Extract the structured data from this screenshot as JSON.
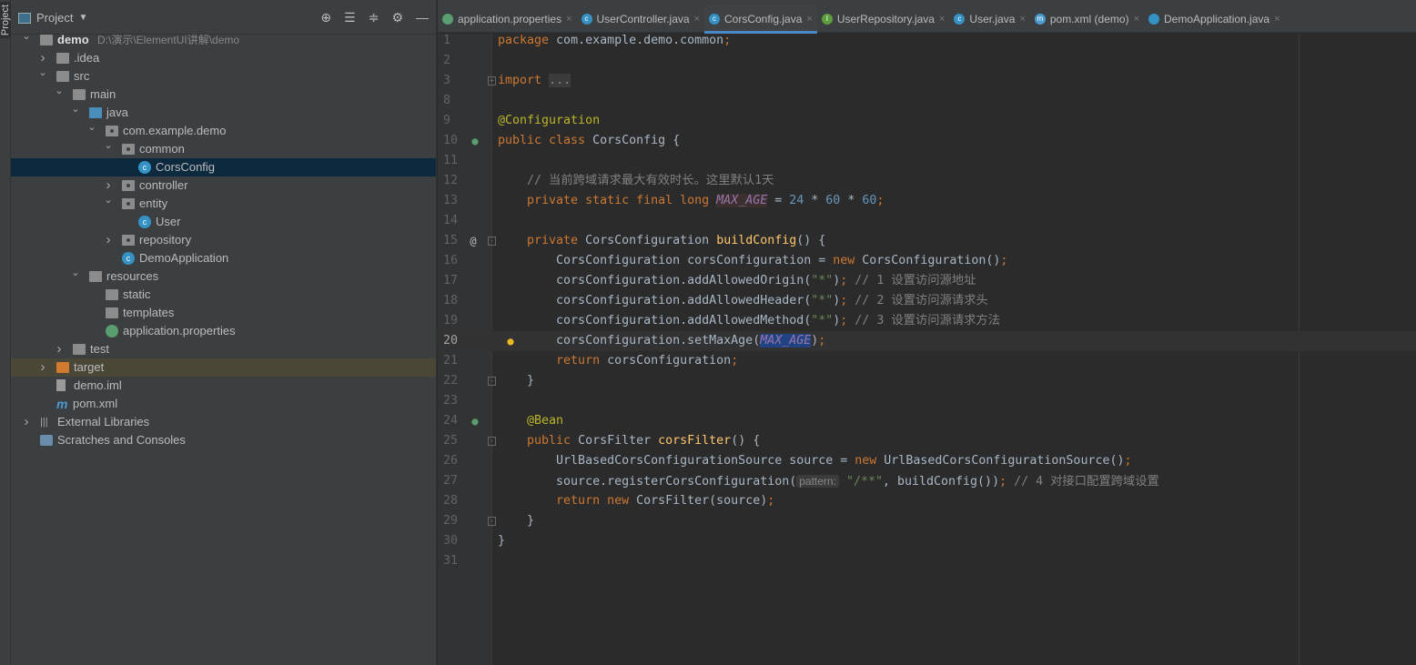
{
  "side_strip": {
    "label": "Project"
  },
  "project_panel": {
    "title": "Project",
    "tree": [
      {
        "label": "demo",
        "level": 0,
        "chevron": "down",
        "icon": "module",
        "bold": true,
        "path": "D:\\演示\\ElementUI讲解\\demo"
      },
      {
        "label": ".idea",
        "level": 1,
        "chevron": "right",
        "icon": "folder"
      },
      {
        "label": "src",
        "level": 1,
        "chevron": "down",
        "icon": "folder"
      },
      {
        "label": "main",
        "level": 2,
        "chevron": "down",
        "icon": "folder"
      },
      {
        "label": "java",
        "level": 3,
        "chevron": "down",
        "icon": "source-folder"
      },
      {
        "label": "com.example.demo",
        "level": 4,
        "chevron": "down",
        "icon": "package"
      },
      {
        "label": "common",
        "level": 5,
        "chevron": "down",
        "icon": "package"
      },
      {
        "label": "CorsConfig",
        "level": 6,
        "chevron": "",
        "icon": "class",
        "selected": true
      },
      {
        "label": "controller",
        "level": 5,
        "chevron": "right",
        "icon": "package"
      },
      {
        "label": "entity",
        "level": 5,
        "chevron": "down",
        "icon": "package"
      },
      {
        "label": "User",
        "level": 6,
        "chevron": "",
        "icon": "class"
      },
      {
        "label": "repository",
        "level": 5,
        "chevron": "right",
        "icon": "package"
      },
      {
        "label": "DemoApplication",
        "level": 5,
        "chevron": "",
        "icon": "spring-class"
      },
      {
        "label": "resources",
        "level": 3,
        "chevron": "down",
        "icon": "resources-folder"
      },
      {
        "label": "static",
        "level": 4,
        "chevron": "",
        "icon": "folder"
      },
      {
        "label": "templates",
        "level": 4,
        "chevron": "",
        "icon": "folder"
      },
      {
        "label": "application.properties",
        "level": 4,
        "chevron": "",
        "icon": "spring-properties"
      },
      {
        "label": "test",
        "level": 2,
        "chevron": "right",
        "icon": "folder"
      },
      {
        "label": "target",
        "level": 1,
        "chevron": "right",
        "icon": "excluded-folder",
        "excluded": true
      },
      {
        "label": "demo.iml",
        "level": 1,
        "chevron": "",
        "icon": "file"
      },
      {
        "label": "pom.xml",
        "level": 1,
        "chevron": "",
        "icon": "maven"
      },
      {
        "label": "External Libraries",
        "level": 0,
        "chevron": "right",
        "icon": "libraries"
      },
      {
        "label": "Scratches and Consoles",
        "level": 0,
        "chevron": "",
        "icon": "scratches"
      }
    ]
  },
  "tabs": [
    {
      "label": "application.properties",
      "icon": "spring-properties",
      "color": "#5a9e6f"
    },
    {
      "label": "UserController.java",
      "icon": "class",
      "color": "#3592c4"
    },
    {
      "label": "CorsConfig.java",
      "icon": "class",
      "color": "#3592c4",
      "active": true
    },
    {
      "label": "UserRepository.java",
      "icon": "interface",
      "color": "#5c9e3c"
    },
    {
      "label": "User.java",
      "icon": "class",
      "color": "#3592c4"
    },
    {
      "label": "pom.xml (demo)",
      "icon": "maven",
      "color": "#4a9bd0"
    },
    {
      "label": "DemoApplication.java",
      "icon": "spring-class",
      "color": "#3592c4"
    }
  ],
  "editor": {
    "current_line": 20,
    "lines": [
      {
        "n": "1",
        "t": [
          [
            "package",
            "kw"
          ],
          [
            " com.example.demo.common",
            "df"
          ],
          [
            ";",
            "kw"
          ]
        ]
      },
      {
        "n": "2",
        "t": []
      },
      {
        "n": "3",
        "fold": "+",
        "t": [
          [
            "import",
            "kw"
          ],
          [
            " ",
            "df"
          ],
          [
            "...",
            "fd"
          ]
        ]
      },
      {
        "n": "8",
        "t": []
      },
      {
        "n": "9",
        "t": [
          [
            "@Configuration",
            "an"
          ]
        ]
      },
      {
        "n": "10",
        "gutter": "spring-bean-icon",
        "t": [
          [
            "public class",
            "kw"
          ],
          [
            " CorsConfig {",
            "df"
          ]
        ]
      },
      {
        "n": "11",
        "t": []
      },
      {
        "n": "12",
        "t": [
          [
            "    // 当前跨域请求最大有效时长。这里默认1天",
            "cm"
          ]
        ]
      },
      {
        "n": "13",
        "t": [
          [
            "    private static final long ",
            "kw"
          ],
          [
            "MAX_AGE",
            "cs hlr"
          ],
          [
            " = ",
            "df"
          ],
          [
            "24",
            "nu"
          ],
          [
            " * ",
            "df"
          ],
          [
            "60",
            "nu"
          ],
          [
            " * ",
            "df"
          ],
          [
            "60",
            "nu"
          ],
          [
            ";",
            "kw"
          ]
        ]
      },
      {
        "n": "14",
        "t": []
      },
      {
        "n": "15",
        "gutter": "at-icon",
        "fold": "-",
        "t": [
          [
            "    private ",
            "kw"
          ],
          [
            "CorsConfiguration ",
            "df"
          ],
          [
            "buildConfig",
            "md"
          ],
          [
            "() {",
            "df"
          ]
        ]
      },
      {
        "n": "16",
        "t": [
          [
            "        CorsConfiguration corsConfiguration = ",
            "df"
          ],
          [
            "new ",
            "kw"
          ],
          [
            "CorsConfiguration()",
            "df"
          ],
          [
            ";",
            "kw"
          ]
        ]
      },
      {
        "n": "17",
        "t": [
          [
            "        corsConfiguration.addAllowedOrigin(",
            "df"
          ],
          [
            "\"*\"",
            "st"
          ],
          [
            ")",
            "df"
          ],
          [
            ";",
            "kw"
          ],
          [
            " // 1 设置访问源地址",
            "cm"
          ]
        ]
      },
      {
        "n": "18",
        "t": [
          [
            "        corsConfiguration.addAllowedHeader(",
            "df"
          ],
          [
            "\"*\"",
            "st"
          ],
          [
            ")",
            "df"
          ],
          [
            ";",
            "kw"
          ],
          [
            " // 2 设置访问源请求头",
            "cm"
          ]
        ]
      },
      {
        "n": "19",
        "t": [
          [
            "        corsConfiguration.addAllowedMethod(",
            "df"
          ],
          [
            "\"*\"",
            "st"
          ],
          [
            ")",
            "df"
          ],
          [
            ";",
            "kw"
          ],
          [
            " // 3 设置访问源请求方法",
            "cm"
          ]
        ]
      },
      {
        "n": "20",
        "gutter": "lightbulb-icon",
        "t": [
          [
            "        corsConfiguration.setMaxAge(",
            "df"
          ],
          [
            "MAX_AGE",
            "cs selw"
          ],
          [
            ")",
            "df"
          ],
          [
            ";",
            "kw"
          ]
        ]
      },
      {
        "n": "21",
        "t": [
          [
            "        return ",
            "kw"
          ],
          [
            "corsConfiguration",
            "df"
          ],
          [
            ";",
            "kw"
          ]
        ]
      },
      {
        "n": "22",
        "fold": "-",
        "t": [
          [
            "    }",
            "df"
          ]
        ]
      },
      {
        "n": "23",
        "t": []
      },
      {
        "n": "24",
        "gutter": "spring-bean-icon",
        "t": [
          [
            "    @Bean",
            "an"
          ]
        ]
      },
      {
        "n": "25",
        "fold": "-",
        "t": [
          [
            "    public ",
            "kw"
          ],
          [
            "CorsFilter ",
            "df"
          ],
          [
            "corsFilter",
            "md"
          ],
          [
            "() {",
            "df"
          ]
        ]
      },
      {
        "n": "26",
        "t": [
          [
            "        UrlBasedCorsConfigurationSource source = ",
            "df"
          ],
          [
            "new ",
            "kw"
          ],
          [
            "UrlBasedCorsConfigurationSource()",
            "df"
          ],
          [
            ";",
            "kw"
          ]
        ]
      },
      {
        "n": "27",
        "t": [
          [
            "        source.registerCorsConfiguration(",
            "df"
          ],
          [
            "pattern:",
            "hint"
          ],
          [
            " ",
            "df"
          ],
          [
            "\"/**\"",
            "st"
          ],
          [
            ", buildConfig())",
            "df"
          ],
          [
            ";",
            "kw"
          ],
          [
            " // 4 对接口配置跨域设置",
            "cm"
          ]
        ]
      },
      {
        "n": "28",
        "t": [
          [
            "        return new ",
            "kw"
          ],
          [
            "CorsFilter(source)",
            "df"
          ],
          [
            ";",
            "kw"
          ]
        ]
      },
      {
        "n": "29",
        "fold": "-",
        "t": [
          [
            "    }",
            "df"
          ]
        ]
      },
      {
        "n": "30",
        "t": [
          [
            "}",
            "df"
          ]
        ]
      },
      {
        "n": "31",
        "t": []
      }
    ]
  }
}
